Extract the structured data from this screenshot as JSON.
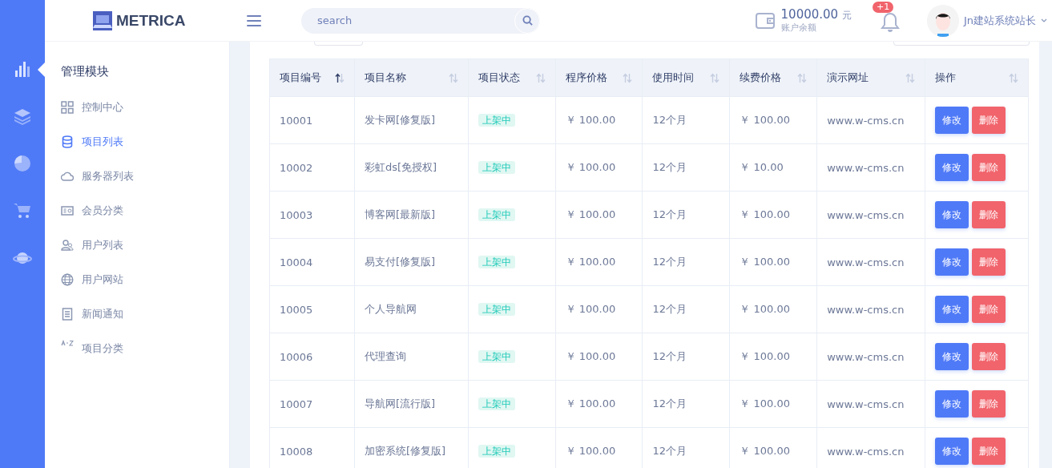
{
  "header": {
    "logo": "METRICA",
    "search": {
      "placeholder": "search"
    },
    "balance": {
      "amount": "10000.00",
      "unit": "元",
      "label": "账户余额"
    },
    "notifications": {
      "badge": "+1"
    },
    "user": {
      "name": "Jn建站系统站长"
    }
  },
  "rail": [
    {
      "selected": true
    },
    {
      "selected": false
    },
    {
      "selected": false
    },
    {
      "selected": false
    },
    {
      "selected": false
    }
  ],
  "sidebar": {
    "title": "管理模块",
    "items": [
      {
        "label": "控制中心",
        "selected": false
      },
      {
        "label": "项目列表",
        "selected": true
      },
      {
        "label": "服务器列表",
        "selected": false
      },
      {
        "label": "会员分类",
        "selected": false
      },
      {
        "label": "用户列表",
        "selected": false
      },
      {
        "label": "用户网站",
        "selected": false
      },
      {
        "label": "新闻通知",
        "selected": false
      },
      {
        "label": "项目分类",
        "selected": false
      }
    ]
  },
  "table": {
    "columns": [
      {
        "label": "项目编号",
        "sorted": true
      },
      {
        "label": "项目名称",
        "sorted": false
      },
      {
        "label": "项目状态",
        "sorted": false
      },
      {
        "label": "程序价格",
        "sorted": false
      },
      {
        "label": "使用时间",
        "sorted": false
      },
      {
        "label": "续费价格",
        "sorted": false
      },
      {
        "label": "演示网址",
        "sorted": false
      },
      {
        "label": "操作",
        "sorted": false
      }
    ],
    "rows": [
      {
        "id": "10001",
        "name": "发卡网[修复版]",
        "status": "上架中",
        "price": "￥ 100.00",
        "term": "12个月",
        "renewal": "￥ 100.00",
        "url": "www.w-cms.cn",
        "actions": [
          "修改",
          "删除"
        ]
      },
      {
        "id": "10002",
        "name": "彩虹ds[免授权]",
        "status": "上架中",
        "price": "￥ 100.00",
        "term": "12个月",
        "renewal": "￥ 10.00",
        "url": "www.w-cms.cn",
        "actions": [
          "修改",
          "删除"
        ]
      },
      {
        "id": "10003",
        "name": "博客网[最新版]",
        "status": "上架中",
        "price": "￥ 100.00",
        "term": "12个月",
        "renewal": "￥ 100.00",
        "url": "www.w-cms.cn",
        "actions": [
          "修改",
          "删除"
        ]
      },
      {
        "id": "10004",
        "name": "易支付[修复版]",
        "status": "上架中",
        "price": "￥ 100.00",
        "term": "12个月",
        "renewal": "￥ 100.00",
        "url": "www.w-cms.cn",
        "actions": [
          "修改",
          "删除"
        ]
      },
      {
        "id": "10005",
        "name": "个人导航网",
        "status": "上架中",
        "price": "￥ 100.00",
        "term": "12个月",
        "renewal": "￥ 100.00",
        "url": "www.w-cms.cn",
        "actions": [
          "修改",
          "删除"
        ]
      },
      {
        "id": "10006",
        "name": "代理查询",
        "status": "上架中",
        "price": "￥ 100.00",
        "term": "12个月",
        "renewal": "￥ 100.00",
        "url": "www.w-cms.cn",
        "actions": [
          "修改",
          "删除"
        ]
      },
      {
        "id": "10007",
        "name": "导航网[流行版]",
        "status": "上架中",
        "price": "￥ 100.00",
        "term": "12个月",
        "renewal": "￥ 100.00",
        "url": "www.w-cms.cn",
        "actions": [
          "修改",
          "删除"
        ]
      },
      {
        "id": "10008",
        "name": "加密系统[修复版]",
        "status": "上架中",
        "price": "￥ 100.00",
        "term": "12个月",
        "renewal": "￥ 100.00",
        "url": "www.w-cms.cn",
        "actions": [
          "修改",
          "删除"
        ]
      }
    ]
  }
}
